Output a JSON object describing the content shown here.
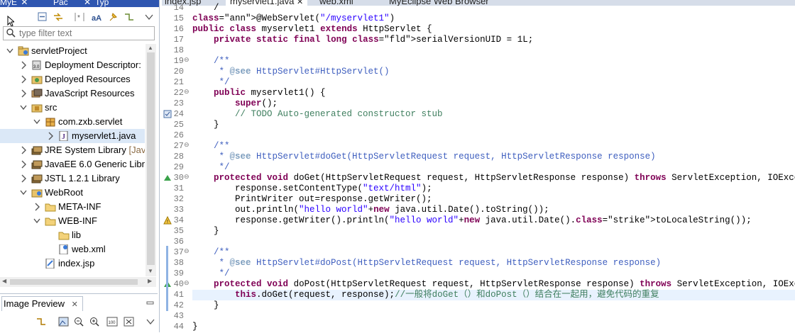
{
  "left_panel": {
    "tabs": [
      {
        "label": "MyE",
        "close": "✕"
      },
      {
        "label": "Pac",
        "close": "✕"
      },
      {
        "label": "Typ",
        "close": ""
      }
    ],
    "filter_placeholder": "type filter text",
    "tree": [
      {
        "label": "servletProject",
        "depth": 0,
        "twisty": "expanded",
        "icon": "project-icon"
      },
      {
        "label": "Deployment Descriptor: ",
        "depth": 1,
        "twisty": "collapsed",
        "icon": "deployment-descriptor-icon"
      },
      {
        "label": "Deployed Resources",
        "depth": 1,
        "twisty": "collapsed",
        "icon": "deployed-resources-icon"
      },
      {
        "label": "JavaScript Resources",
        "depth": 1,
        "twisty": "collapsed",
        "icon": "javascript-resources-icon"
      },
      {
        "label": "src",
        "depth": 1,
        "twisty": "expanded",
        "icon": "source-folder-icon"
      },
      {
        "label": "com.zxb.servlet",
        "depth": 2,
        "twisty": "expanded",
        "icon": "package-icon"
      },
      {
        "label": "myservlet1.java",
        "depth": 3,
        "twisty": "collapsed",
        "icon": "java-file-icon",
        "selected": true
      },
      {
        "label": "JRE System Library ",
        "suffix": "[Java",
        "depth": 1,
        "twisty": "collapsed",
        "icon": "library-icon"
      },
      {
        "label": "JavaEE 6.0 Generic Libra",
        "depth": 1,
        "twisty": "collapsed",
        "icon": "library-icon"
      },
      {
        "label": "JSTL 1.2.1 Library",
        "depth": 1,
        "twisty": "collapsed",
        "icon": "library-icon"
      },
      {
        "label": "WebRoot",
        "depth": 1,
        "twisty": "expanded",
        "icon": "webroot-folder-icon"
      },
      {
        "label": "META-INF",
        "depth": 2,
        "twisty": "collapsed",
        "icon": "folder-icon"
      },
      {
        "label": "WEB-INF",
        "depth": 2,
        "twisty": "expanded",
        "icon": "folder-icon"
      },
      {
        "label": "lib",
        "depth": 3,
        "twisty": "none",
        "icon": "folder-icon"
      },
      {
        "label": "web.xml",
        "depth": 3,
        "twisty": "none",
        "icon": "xml-file-icon"
      },
      {
        "label": "index.jsp",
        "depth": 2,
        "twisty": "none",
        "icon": "jsp-file-icon"
      }
    ],
    "image_preview_tab": "Image Preview",
    "image_preview_close": "✕"
  },
  "editor": {
    "tabs": [
      {
        "label": "index.jsp",
        "active": false
      },
      {
        "label": "myservlet1.java",
        "active": true,
        "close": "✕"
      },
      {
        "label": "web.xml",
        "active": false
      },
      {
        "label": "MyEclipse Web Browser",
        "active": false
      }
    ],
    "lines": [
      {
        "n": "14",
        "t": "    /"
      },
      {
        "n": "15",
        "t": "@WebServlet(\"/myservlet1\")"
      },
      {
        "n": "16",
        "t": "public class myservlet1 extends HttpServlet {"
      },
      {
        "n": "17",
        "t": "    private static final long serialVersionUID = 1L;"
      },
      {
        "n": "18",
        "t": ""
      },
      {
        "n": "19",
        "t": "    /**",
        "fold": "⊖"
      },
      {
        "n": "20",
        "t": "     * @see HttpServlet#HttpServlet()"
      },
      {
        "n": "21",
        "t": "     */"
      },
      {
        "n": "22",
        "t": "    public myservlet1() {",
        "fold": "⊖"
      },
      {
        "n": "23",
        "t": "        super();"
      },
      {
        "n": "24",
        "t": "        // TODO Auto-generated constructor stub",
        "mark": "task"
      },
      {
        "n": "25",
        "t": "    }"
      },
      {
        "n": "26",
        "t": ""
      },
      {
        "n": "27",
        "t": "    /**",
        "fold": "⊖"
      },
      {
        "n": "28",
        "t": "     * @see HttpServlet#doGet(HttpServletRequest request, HttpServletResponse response)"
      },
      {
        "n": "29",
        "t": "     */"
      },
      {
        "n": "30",
        "t": "    protected void doGet(HttpServletRequest request, HttpServletResponse response) throws ServletException, IOException {",
        "fold": "⊖",
        "mark": "override"
      },
      {
        "n": "31",
        "t": "        response.setContentType(\"text/html\");"
      },
      {
        "n": "32",
        "t": "        PrintWriter out=response.getWriter();"
      },
      {
        "n": "33",
        "t": "        out.println(\"hello world\"+new java.util.Date().toString());"
      },
      {
        "n": "34",
        "t": "        response.getWriter().println(\"hello world\"+new java.util.Date().toLocaleString());",
        "mark": "warning"
      },
      {
        "n": "35",
        "t": "    }"
      },
      {
        "n": "36",
        "t": ""
      },
      {
        "n": "37",
        "t": "    /**",
        "fold": "⊖"
      },
      {
        "n": "38",
        "t": "     * @see HttpServlet#doPost(HttpServletRequest request, HttpServletResponse response)"
      },
      {
        "n": "39",
        "t": "     */"
      },
      {
        "n": "40",
        "t": "    protected void doPost(HttpServletRequest request, HttpServletResponse response) throws ServletException, IOException {",
        "fold": "⊖",
        "mark": "override"
      },
      {
        "n": "41",
        "t": "        this.doGet(request, response);//一般将doGet（）和doPost（）结合在一起用，避免代码的重复",
        "current": true
      },
      {
        "n": "42",
        "t": "    }"
      },
      {
        "n": "43",
        "t": ""
      },
      {
        "n": "44",
        "t": "}"
      }
    ]
  },
  "colors": {
    "keyword": "#7f0055",
    "string": "#2a00ff",
    "comment": "#3f7f5f",
    "javadoc": "#3f5fbf",
    "annotation": "#646464",
    "field": "#0000c0",
    "current_line": "#e8f2fe",
    "selection": "#dbe8f7"
  }
}
